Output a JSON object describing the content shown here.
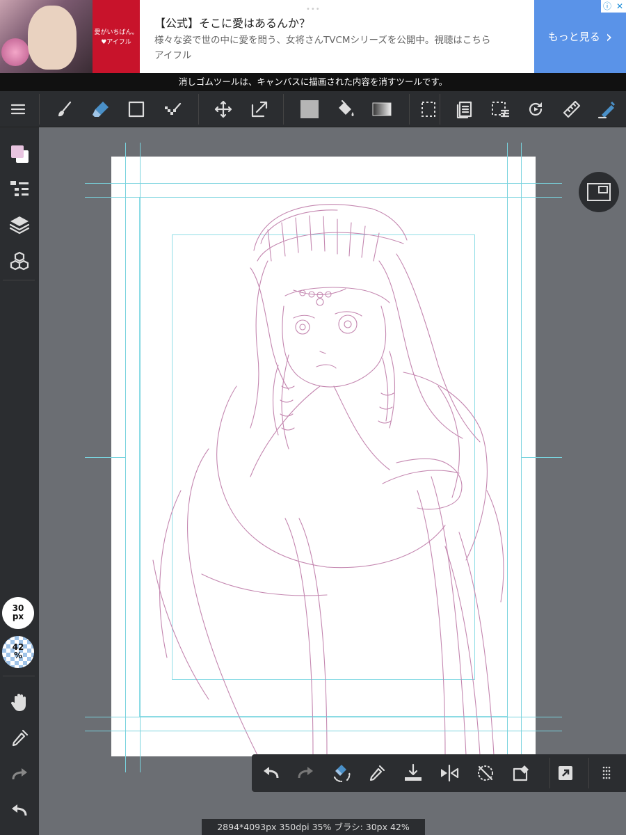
{
  "ad": {
    "title": "【公式】そこに愛はあるんか？",
    "description": "様々な姿で世の中に愛を問う、女将さんTVCMシリーズを公開中。視聴はこちら",
    "brand": "アイフル",
    "logo_text_1": "愛がいちばん。",
    "logo_text_2": "♥アイフル",
    "cta_label": "もっと見る",
    "cta_arrow": "›",
    "info_icon": "ⓘ",
    "close_icon": "✕",
    "dots": "•••"
  },
  "hint": "消しゴムツールは、キャンバスに描画された内容を消すツールです。",
  "toolbar": {
    "icons": [
      "menu-icon",
      "brush-icon",
      "eraser-icon",
      "rectangle-icon",
      "dot-pen-icon",
      "move-icon",
      "transform-icon",
      "fill-color-icon",
      "bucket-icon",
      "gradient-icon",
      "selection-icon",
      "layers-copy-icon",
      "selection-menu-icon",
      "rotate-icon",
      "ruler-icon",
      "snap-icon"
    ]
  },
  "left_panel": {
    "brush_size_value": "30",
    "brush_size_unit": "px",
    "opacity_value": "42",
    "opacity_unit": "%"
  },
  "status": "2894*4093px 350dpi 35% ブラシ: 30px 42%",
  "colors": {
    "accent": "#4a90c8",
    "primary_color_swatch": "#e8c4e0",
    "sketch_line": "#c487b0",
    "guide": "#79d3de"
  }
}
